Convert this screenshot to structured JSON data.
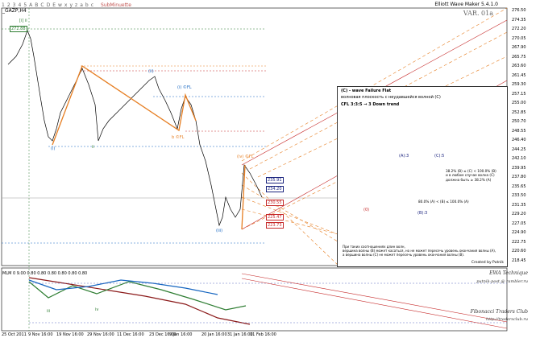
{
  "toolbar": {
    "items": [
      "1",
      "2",
      "3",
      "4",
      "5",
      "A",
      "B",
      "C",
      "D",
      "E",
      "w",
      "x",
      "y",
      "z",
      "a",
      "b",
      "c"
    ],
    "extra": "SubMinuette"
  },
  "chart_title": "_GAZP,H4",
  "version": "Elliott Wave Maker 5.4.1.0",
  "var_label": "VAR. 01a",
  "y_ticks": [
    "276.50",
    "274.35",
    "272.20",
    "270.05",
    "267.90",
    "265.75",
    "263.60",
    "261.45",
    "259.30",
    "257.15",
    "255.00",
    "252.85",
    "250.70",
    "248.55",
    "246.40",
    "244.25",
    "242.10",
    "239.95",
    "237.80",
    "235.65",
    "233.50",
    "231.35",
    "229.20",
    "227.05",
    "224.90",
    "222.75",
    "220.60",
    "218.45"
  ],
  "x_ticks": [
    "25 Oct 2011",
    "9 Nov 16:00",
    "19 Nov 16:00",
    "29 Nov 16:00",
    "11 Dec 16:00",
    "23 Dec 16:00",
    "9 Jan 16:00",
    "20 Jan 16:00",
    "31 Jan 16:00",
    "11 Feb 16:00"
  ],
  "price_tags": [
    {
      "text": "272.88",
      "color": "#2e7d32"
    },
    {
      "text": "235.91",
      "color": "#1a237e"
    },
    {
      "text": "234.20",
      "color": "#1a237e"
    },
    {
      "text": "230.55",
      "color": "#c62828"
    },
    {
      "text": "225.47",
      "color": "#c62828"
    },
    {
      "text": "223.73",
      "color": "#c62828"
    }
  ],
  "wave_labels": [
    {
      "text": "[i] ii",
      "color": "#2e7d32"
    },
    {
      "text": "(i)",
      "color": "#1565c0"
    },
    {
      "text": "(ii)",
      "color": "#1565c0"
    },
    {
      "text": "(i) ©FL",
      "color": "#1565c0"
    },
    {
      "text": "(iii)",
      "color": "#1565c0"
    },
    {
      "text": "(iv) ©FL",
      "color": "#e67e22"
    },
    {
      "text": "ii",
      "color": "#2e7d32"
    },
    {
      "text": "b ©FL",
      "color": "#e67e22"
    },
    {
      "text": "iii",
      "color": "#2e7d32"
    },
    {
      "text": "iv",
      "color": "#2e7d32"
    }
  ],
  "info_box": {
    "title": "(C) - wave Failure Flat",
    "subtitle": "волновая плоскость с неудавшейся волной (C)",
    "cfl": "CFL 3:3:5 → 3 Down trend",
    "labels": [
      "(A):3",
      "(C):5",
      "(0)",
      "(B):3"
    ],
    "conds": "38.2% (B) ≤ (C) < 100.0% (B)\nи в любом случае волна (C)\nдолжна быть ≥ 38.2% (A)",
    "cond2": "80.0% (A) < (B) ≤ 100.0% (A)",
    "note": "При таких соотношениях длин волн,\nвершина волны (B) может касаться, но не может пересечь уровень окончания волны (A),\nа вершина волны (C) не может пересечь уровень окончания волны (B).",
    "created": "Created by Putnik"
  },
  "indicator_label": "MLM 0 9.00 0.80 0.80 0.80 0.80 0.80 0.80",
  "brands": [
    "EWA Technique",
    "putnik-post @ rambler.ru",
    "Fibonacci Traders Club",
    "http://tradersclub.ru"
  ]
}
